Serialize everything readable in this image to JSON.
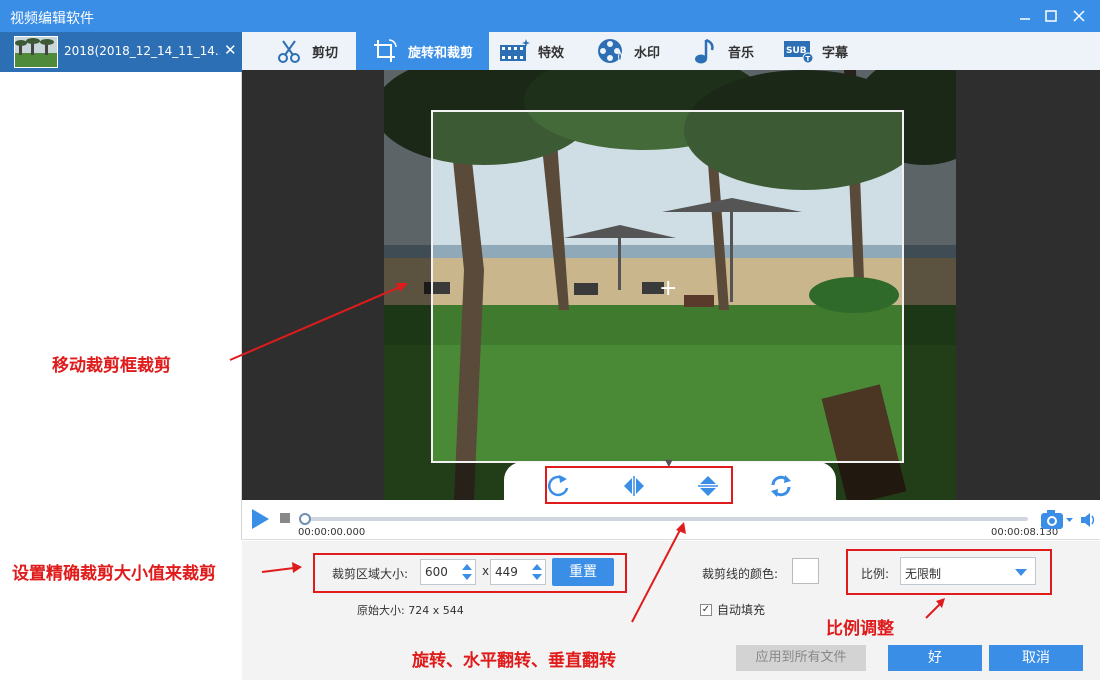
{
  "window": {
    "title": "视频编辑软件",
    "min_icon": "minimize-icon",
    "max_icon": "maximize-icon",
    "close_icon": "close-icon"
  },
  "file": {
    "name": "2018(2018_12_14_11_14...",
    "close_glyph": "✕"
  },
  "tabs": [
    {
      "label": "剪切",
      "icon": "scissors-icon",
      "active": false
    },
    {
      "label": "旋转和裁剪",
      "icon": "crop-rotate-icon",
      "active": true
    },
    {
      "label": "特效",
      "icon": "film-effects-icon",
      "active": false
    },
    {
      "label": "水印",
      "icon": "watermark-reel-icon",
      "active": false
    },
    {
      "label": "音乐",
      "icon": "music-note-icon",
      "active": false
    },
    {
      "label": "字幕",
      "icon": "subtitle-icon",
      "active": false
    }
  ],
  "playback": {
    "current_time": "00:00:00.000",
    "total_time": "00:00:08.130",
    "progress": 0
  },
  "crop": {
    "size_label": "裁剪区域大小:",
    "width": "600",
    "height": "449",
    "times": "x",
    "reset_label": "重置",
    "original_size": "原始大小:   724 x 544",
    "color_label": "裁剪线的颜色:",
    "autofill_label": "自动填充",
    "autofill_checked": true,
    "ratio_label": "比例:",
    "ratio_value": "无限制"
  },
  "actions": {
    "apply_all": "应用到所有文件",
    "ok": "好",
    "cancel": "取消"
  },
  "annotations": {
    "move_crop": "移动裁剪框裁剪",
    "precise_size": "设置精确裁剪大小值来裁剪",
    "ratio_adjust": "比例调整",
    "rotate_flip": "旋转、水平翻转、垂直翻转"
  },
  "colors": {
    "accent": "#3a8ee6",
    "annotation": "#e01b1b",
    "preview_bg": "#2e2e2e"
  }
}
